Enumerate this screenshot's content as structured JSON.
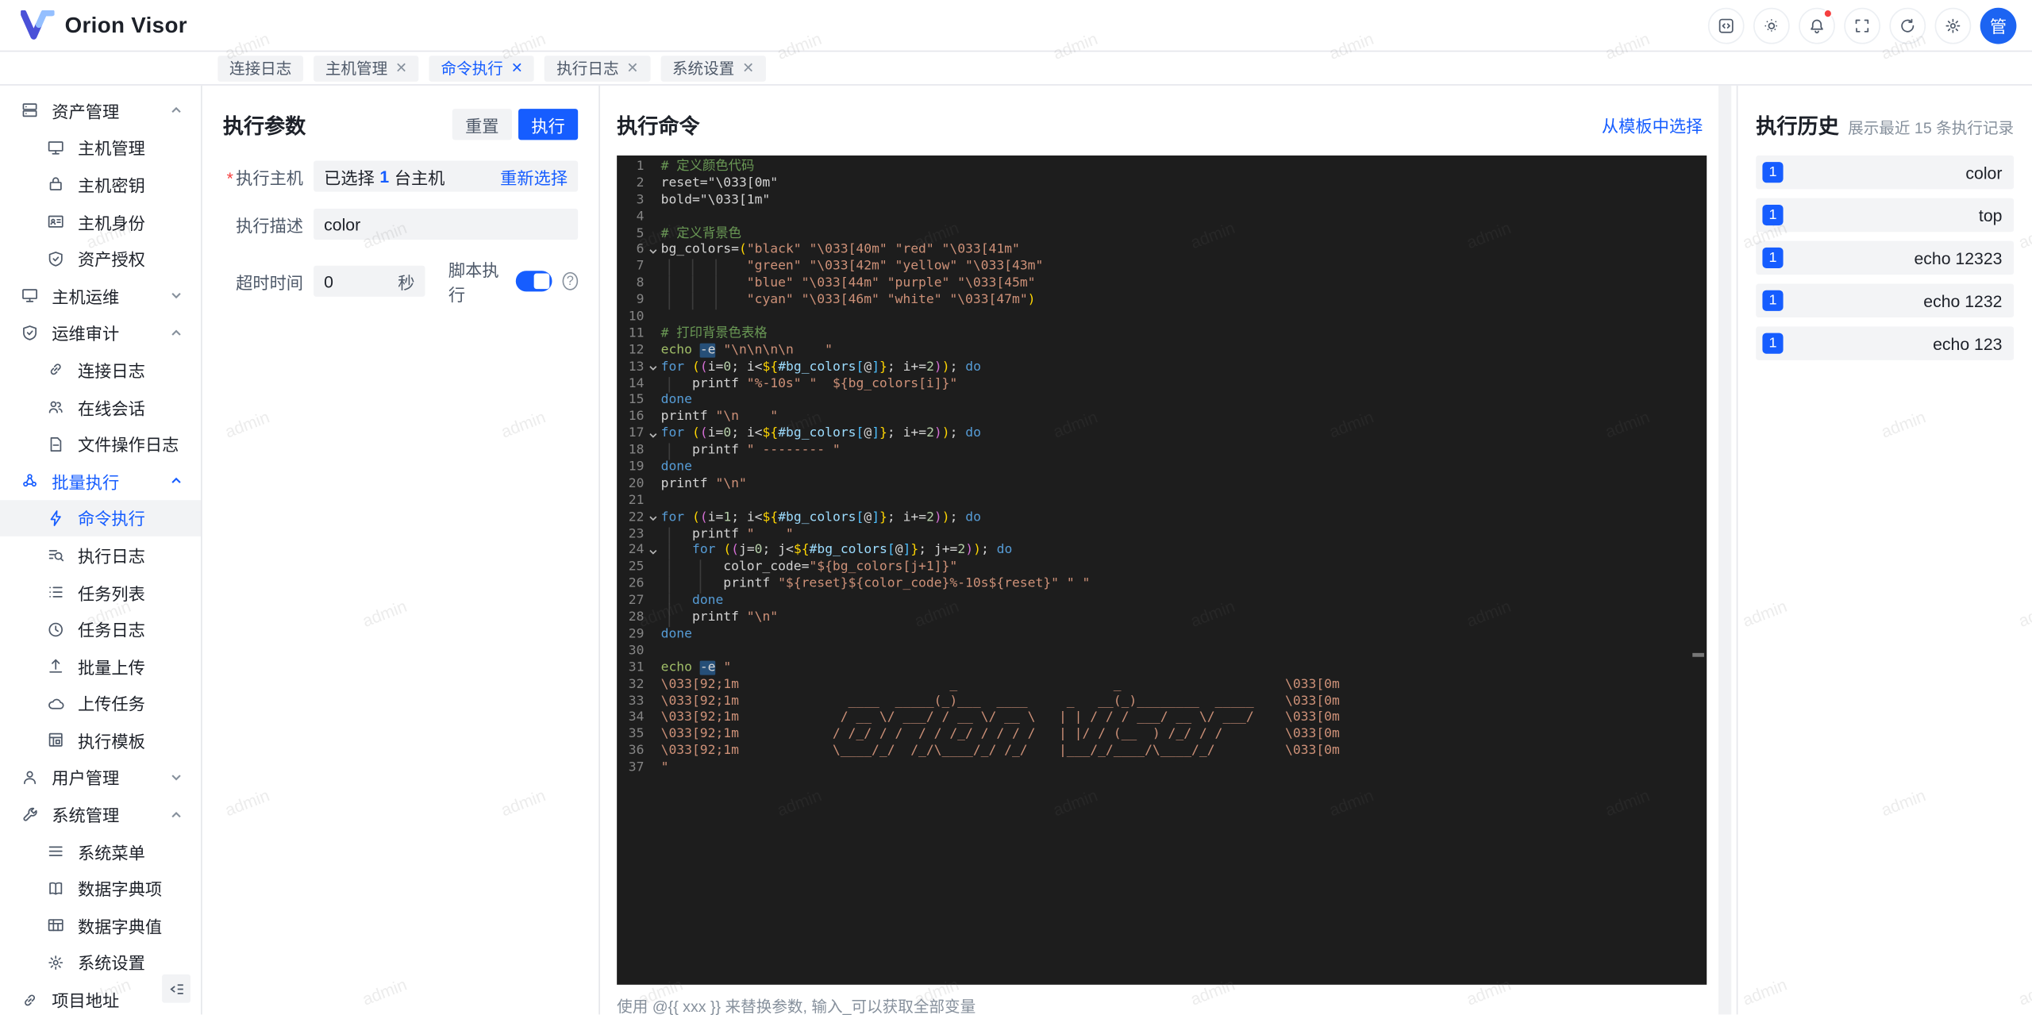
{
  "header": {
    "logo_text": "Orion Visor",
    "avatar_text": "管",
    "icons": [
      {
        "name": "code-window-icon"
      },
      {
        "name": "theme-icon"
      },
      {
        "name": "notifications-icon",
        "dot": true
      },
      {
        "name": "fullscreen-icon"
      },
      {
        "name": "refresh-icon"
      },
      {
        "name": "settings-icon"
      }
    ]
  },
  "tabs": [
    {
      "label": "连接日志",
      "closable": false,
      "active": false
    },
    {
      "label": "主机管理",
      "closable": true,
      "active": false
    },
    {
      "label": "命令执行",
      "closable": true,
      "active": true
    },
    {
      "label": "执行日志",
      "closable": true,
      "active": false
    },
    {
      "label": "系统设置",
      "closable": true,
      "active": false
    }
  ],
  "sidebar": {
    "items": [
      {
        "type": "group",
        "icon": "server-icon",
        "label": "资产管理",
        "chev": "up"
      },
      {
        "type": "sub",
        "icon": "monitor-icon",
        "label": "主机管理"
      },
      {
        "type": "sub",
        "icon": "lock-icon",
        "label": "主机密钥"
      },
      {
        "type": "sub",
        "icon": "idcard-icon",
        "label": "主机身份"
      },
      {
        "type": "sub",
        "icon": "shield-check-icon",
        "label": "资产授权"
      },
      {
        "type": "group",
        "icon": "monitor-icon",
        "label": "主机运维",
        "chev": "down"
      },
      {
        "type": "group",
        "icon": "shield-check-icon",
        "label": "运维审计",
        "chev": "up"
      },
      {
        "type": "sub",
        "icon": "link-icon",
        "label": "连接日志"
      },
      {
        "type": "sub",
        "icon": "users-icon",
        "label": "在线会话"
      },
      {
        "type": "sub",
        "icon": "file-icon",
        "label": "文件操作日志"
      },
      {
        "type": "group",
        "icon": "cluster-icon",
        "label": "批量执行",
        "chev": "up",
        "blue": true
      },
      {
        "type": "sub",
        "icon": "bolt-icon",
        "label": "命令执行",
        "selected": true
      },
      {
        "type": "sub",
        "icon": "search-list-icon",
        "label": "执行日志"
      },
      {
        "type": "sub",
        "icon": "list-icon",
        "label": "任务列表"
      },
      {
        "type": "sub",
        "icon": "clock-icon",
        "label": "任务日志"
      },
      {
        "type": "sub",
        "icon": "upload-icon",
        "label": "批量上传"
      },
      {
        "type": "sub",
        "icon": "cloud-icon",
        "label": "上传任务"
      },
      {
        "type": "sub",
        "icon": "template-icon",
        "label": "执行模板"
      },
      {
        "type": "group",
        "icon": "user-icon",
        "label": "用户管理",
        "chev": "down"
      },
      {
        "type": "group",
        "icon": "wrench-icon",
        "label": "系统管理",
        "chev": "up"
      },
      {
        "type": "sub",
        "icon": "menu-icon",
        "label": "系统菜单"
      },
      {
        "type": "sub",
        "icon": "book-icon",
        "label": "数据字典项"
      },
      {
        "type": "sub",
        "icon": "table-icon",
        "label": "数据字典值"
      },
      {
        "type": "sub",
        "icon": "gear-icon",
        "label": "系统设置"
      },
      {
        "type": "group",
        "icon": "link-icon",
        "label": "项目地址",
        "chev": "none"
      }
    ]
  },
  "exec_params": {
    "title": "执行参数",
    "reset_label": "重置",
    "run_label": "执行",
    "host_label": "执行主机",
    "host_prefix": "已选择",
    "host_count": "1",
    "host_suffix": "台主机",
    "reselect_label": "重新选择",
    "desc_label": "执行描述",
    "desc_value": "color",
    "timeout_label": "超时时间",
    "timeout_value": "0",
    "timeout_unit": "秒",
    "script_label": "脚本执行",
    "script_on": true,
    "help_glyph": "?"
  },
  "exec_command": {
    "title": "执行命令",
    "template_link": "从模板中选择",
    "hint": "使用 @{{ xxx }} 来替换参数, 输入_可以获取全部变量",
    "code_lines": [
      {
        "t": [
          [
            "c",
            "# 定义颜色代码"
          ]
        ]
      },
      {
        "t": [
          [
            "p",
            "reset=\"\\033[0m\""
          ]
        ]
      },
      {
        "t": [
          [
            "p",
            "bold=\"\\033[1m\""
          ]
        ]
      },
      {
        "t": []
      },
      {
        "t": [
          [
            "c",
            "# 定义背景色"
          ]
        ]
      },
      {
        "f": 1,
        "t": [
          [
            "p",
            "bg_colors="
          ],
          [
            "g",
            "("
          ],
          [
            "s",
            "\"black\" \"\\033[40m\" \"red\" \"\\033[41m\""
          ]
        ]
      },
      {
        "g": [
          1,
          4,
          7
        ],
        "t": [
          [
            "p",
            "           "
          ],
          [
            "s",
            "\"green\" \"\\033[42m\" \"yellow\" \"\\033[43m\""
          ]
        ]
      },
      {
        "g": [
          1,
          4,
          7
        ],
        "t": [
          [
            "p",
            "           "
          ],
          [
            "s",
            "\"blue\" \"\\033[44m\" \"purple\" \"\\033[45m\""
          ]
        ]
      },
      {
        "g": [
          1,
          4,
          7
        ],
        "t": [
          [
            "p",
            "           "
          ],
          [
            "s",
            "\"cyan\" \"\\033[46m\" \"white\" \"\\033[47m\""
          ],
          [
            "g",
            ")"
          ]
        ]
      },
      {
        "t": []
      },
      {
        "t": [
          [
            "c",
            "# 打印背景色表格"
          ]
        ]
      },
      {
        "t": [
          [
            "e",
            "echo"
          ],
          [
            "p",
            " "
          ],
          [
            "hl",
            "-e"
          ],
          [
            "p",
            " "
          ],
          [
            "s",
            "\"\\n\\n\\n\\n    \""
          ]
        ]
      },
      {
        "f": 1,
        "t": [
          [
            "k",
            "for"
          ],
          [
            "p",
            " "
          ],
          [
            "g",
            "("
          ],
          [
            "m",
            "("
          ],
          [
            "p",
            "i="
          ],
          [
            "n",
            "0"
          ],
          [
            "p",
            "; i<"
          ],
          [
            "g",
            "${"
          ],
          [
            "v",
            "#bg_colors"
          ],
          [
            "b",
            "["
          ],
          [
            "p",
            "@"
          ],
          [
            "b",
            "]"
          ],
          [
            "g",
            "}"
          ],
          [
            "p",
            "; i+="
          ],
          [
            "n",
            "2"
          ],
          [
            "m",
            ")"
          ],
          [
            "g",
            ")"
          ],
          [
            "p",
            "; "
          ],
          [
            "k",
            "do"
          ]
        ]
      },
      {
        "g": [
          1
        ],
        "t": [
          [
            "p",
            "    printf "
          ],
          [
            "s",
            "\"%-10s\""
          ],
          [
            "p",
            " "
          ],
          [
            "s",
            "\"  ${bg_colors[i]}\""
          ]
        ]
      },
      {
        "t": [
          [
            "k",
            "done"
          ]
        ]
      },
      {
        "t": [
          [
            "p",
            "printf "
          ],
          [
            "s",
            "\"\\n    \""
          ]
        ]
      },
      {
        "f": 1,
        "t": [
          [
            "k",
            "for"
          ],
          [
            "p",
            " "
          ],
          [
            "g",
            "("
          ],
          [
            "m",
            "("
          ],
          [
            "p",
            "i="
          ],
          [
            "n",
            "0"
          ],
          [
            "p",
            "; i<"
          ],
          [
            "g",
            "${"
          ],
          [
            "v",
            "#bg_colors"
          ],
          [
            "b",
            "["
          ],
          [
            "p",
            "@"
          ],
          [
            "b",
            "]"
          ],
          [
            "g",
            "}"
          ],
          [
            "p",
            "; i+="
          ],
          [
            "n",
            "2"
          ],
          [
            "m",
            ")"
          ],
          [
            "g",
            ")"
          ],
          [
            "p",
            "; "
          ],
          [
            "k",
            "do"
          ]
        ]
      },
      {
        "g": [
          1
        ],
        "t": [
          [
            "p",
            "    printf "
          ],
          [
            "s",
            "\" -------- \""
          ]
        ]
      },
      {
        "t": [
          [
            "k",
            "done"
          ]
        ]
      },
      {
        "t": [
          [
            "p",
            "printf "
          ],
          [
            "s",
            "\"\\n\""
          ]
        ]
      },
      {
        "t": []
      },
      {
        "f": 1,
        "t": [
          [
            "k",
            "for"
          ],
          [
            "p",
            " "
          ],
          [
            "g",
            "("
          ],
          [
            "m",
            "("
          ],
          [
            "p",
            "i="
          ],
          [
            "n",
            "1"
          ],
          [
            "p",
            "; i<"
          ],
          [
            "g",
            "${"
          ],
          [
            "v",
            "#bg_colors"
          ],
          [
            "b",
            "["
          ],
          [
            "p",
            "@"
          ],
          [
            "b",
            "]"
          ],
          [
            "g",
            "}"
          ],
          [
            "p",
            "; i+="
          ],
          [
            "n",
            "2"
          ],
          [
            "m",
            ")"
          ],
          [
            "g",
            ")"
          ],
          [
            "p",
            "; "
          ],
          [
            "k",
            "do"
          ]
        ]
      },
      {
        "g": [
          1
        ],
        "t": [
          [
            "p",
            "    printf "
          ],
          [
            "s",
            "\"    \""
          ]
        ]
      },
      {
        "f": 1,
        "g": [
          1
        ],
        "t": [
          [
            "p",
            "    "
          ],
          [
            "k",
            "for"
          ],
          [
            "p",
            " "
          ],
          [
            "g",
            "("
          ],
          [
            "m",
            "("
          ],
          [
            "p",
            "j="
          ],
          [
            "n",
            "0"
          ],
          [
            "p",
            "; j<"
          ],
          [
            "g",
            "${"
          ],
          [
            "v",
            "#bg_colors"
          ],
          [
            "b",
            "["
          ],
          [
            "p",
            "@"
          ],
          [
            "b",
            "]"
          ],
          [
            "g",
            "}"
          ],
          [
            "p",
            "; j+="
          ],
          [
            "n",
            "2"
          ],
          [
            "m",
            ")"
          ],
          [
            "g",
            ")"
          ],
          [
            "p",
            "; "
          ],
          [
            "k",
            "do"
          ]
        ]
      },
      {
        "g": [
          1,
          5
        ],
        "t": [
          [
            "p",
            "        color_code="
          ],
          [
            "s",
            "\"${bg_colors[j+1]}\""
          ]
        ]
      },
      {
        "g": [
          1,
          5
        ],
        "t": [
          [
            "p",
            "        printf "
          ],
          [
            "s",
            "\"${reset}${color_code}%-10s${reset}\""
          ],
          [
            "p",
            " "
          ],
          [
            "s",
            "\" \""
          ]
        ]
      },
      {
        "g": [
          1
        ],
        "t": [
          [
            "p",
            "    "
          ],
          [
            "k",
            "done"
          ]
        ]
      },
      {
        "g": [
          1
        ],
        "t": [
          [
            "p",
            "    printf "
          ],
          [
            "s",
            "\"\\n\""
          ]
        ]
      },
      {
        "t": [
          [
            "k",
            "done"
          ]
        ]
      },
      {
        "t": []
      },
      {
        "t": [
          [
            "e",
            "echo"
          ],
          [
            "p",
            " "
          ],
          [
            "hl",
            "-e"
          ],
          [
            "p",
            " "
          ],
          [
            "s",
            "\""
          ]
        ]
      },
      {
        "t": [
          [
            "s",
            "\\033[92;1m                           _                    _                     \\033[0m"
          ]
        ]
      },
      {
        "t": [
          [
            "s",
            "\\033[92;1m              ____  _____(_)___  ____     _   __(_)________  _____    \\033[0m"
          ]
        ]
      },
      {
        "t": [
          [
            "s",
            "\\033[92;1m             / __ \\/ ___/ / __ \\/ __ \\   | | / / / ___/ __ \\/ ___/    \\033[0m"
          ]
        ]
      },
      {
        "t": [
          [
            "s",
            "\\033[92;1m            / /_/ / /  / / /_/ / / / /   | |/ / (__  ) /_/ / /        \\033[0m"
          ]
        ]
      },
      {
        "t": [
          [
            "s",
            "\\033[92;1m            \\____/_/  /_/\\____/_/ /_/    |___/_/____/\\____/_/         \\033[0m"
          ]
        ]
      },
      {
        "t": [
          [
            "s",
            "\""
          ]
        ]
      }
    ]
  },
  "exec_history": {
    "title": "执行历史",
    "subtitle": "展示最近 15 条执行记录",
    "items": [
      {
        "count": "1",
        "text": "color"
      },
      {
        "count": "1",
        "text": "top"
      },
      {
        "count": "1",
        "text": "echo 12323"
      },
      {
        "count": "1",
        "text": "echo 1232"
      },
      {
        "count": "1",
        "text": "echo 123"
      }
    ]
  },
  "watermark": {
    "text": "admin"
  },
  "colors": {
    "accent": "#165dff",
    "danger": "#f53f3f",
    "editor_bg": "#1d1d1d"
  }
}
